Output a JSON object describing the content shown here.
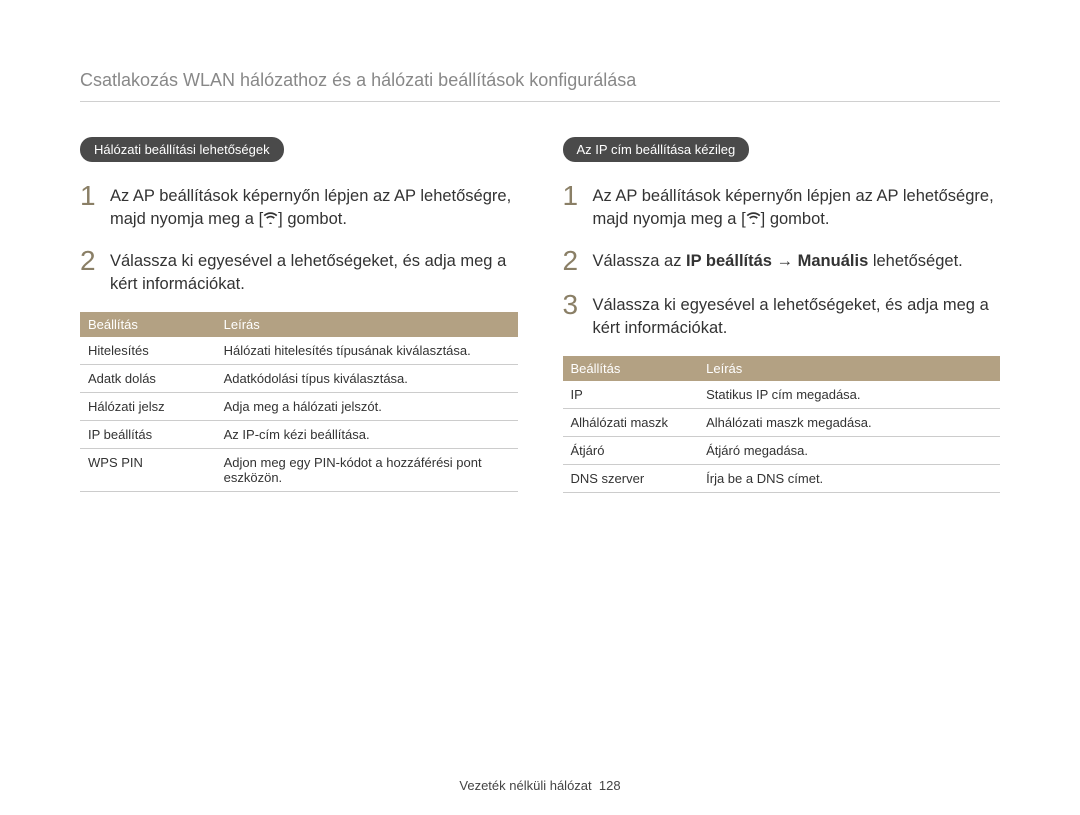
{
  "header_title": "Csatlakozás WLAN hálózathoz és a hálózati beállítások konﬁgurálása",
  "left": {
    "section_label": "Hálózati beállítási lehetőségek",
    "steps": [
      {
        "n": "1",
        "text_before": "Az AP beállítások képernyőn lépjen az AP lehetőségre, majd nyomja meg a [",
        "text_after": "] gombot."
      },
      {
        "n": "2",
        "text": "Válassza ki egyesével a lehetőségeket, és adja meg a kért információkat."
      }
    ],
    "table": {
      "head": [
        "Beállítás",
        "Leírás"
      ],
      "rows": [
        [
          "Hitelesítés",
          "Hálózati hitelesítés típusának kiválasztása."
        ],
        [
          "Adatk dolás",
          "Adatkódolási típus kiválasztása."
        ],
        [
          "Hálózati jelsz",
          "Adja meg a hálózati jelszót."
        ],
        [
          "IP beállítás",
          "Az IP-cím kézi beállítása."
        ],
        [
          "WPS PIN",
          "Adjon meg egy PIN-kódot a hozzáférési pont eszközön."
        ]
      ]
    }
  },
  "right": {
    "section_label": "Az IP cím beállítása kézileg",
    "steps": [
      {
        "n": "1",
        "text_before": "Az AP beállítások képernyőn lépjen az AP lehetőségre, majd nyomja meg a [",
        "text_after": "] gombot."
      },
      {
        "n": "2",
        "text_a": "Válassza az ",
        "text_b": "IP beállítás",
        "text_c": " → ",
        "text_d": "Manuális",
        "text_e": " lehetőséget."
      },
      {
        "n": "3",
        "text": "Válassza ki egyesével a lehetőségeket, és adja meg a kért információkat."
      }
    ],
    "table": {
      "head": [
        "Beállítás",
        "Leírás"
      ],
      "rows": [
        [
          "IP",
          "Statikus IP cím megadása."
        ],
        [
          "Alhálózati maszk",
          "Alhálózati maszk megadása."
        ],
        [
          "Átjáró",
          "Átjáró megadása."
        ],
        [
          "DNS szerver",
          "Írja be a DNS címet."
        ]
      ]
    }
  },
  "footer": {
    "category": "Vezeték nélküli hálózat",
    "page": "128"
  }
}
